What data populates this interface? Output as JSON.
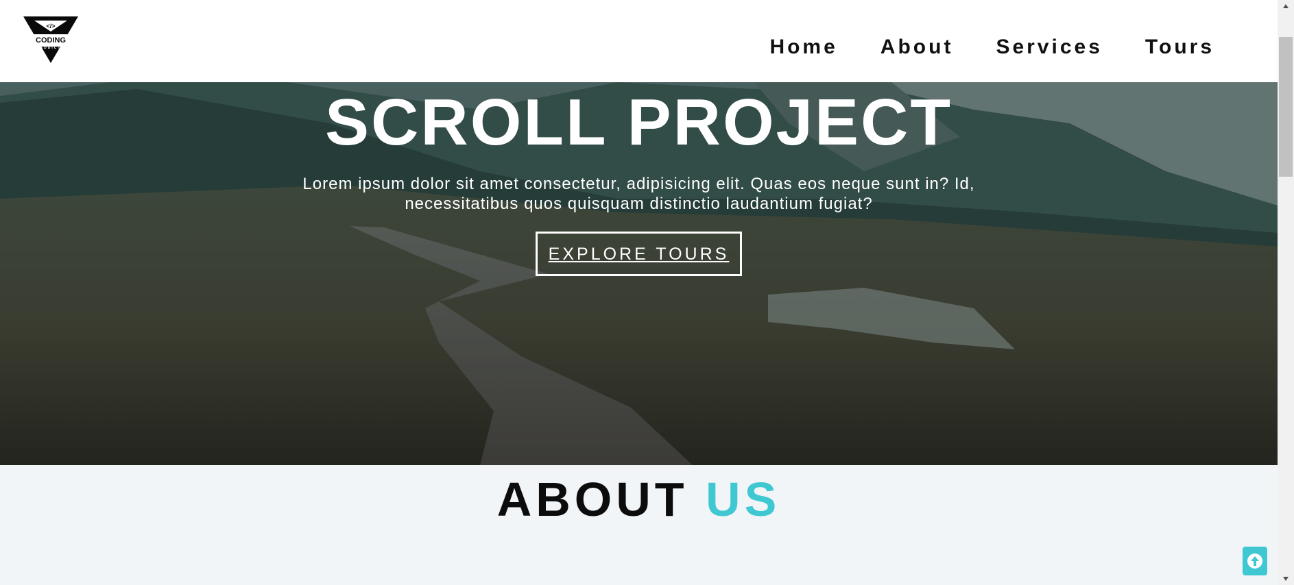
{
  "brand": {
    "logo_text": "CODING",
    "logo_subtext": "ADDICT",
    "logo_icon": "code-brackets-icon"
  },
  "nav": {
    "items": [
      {
        "label": "Home"
      },
      {
        "label": "About"
      },
      {
        "label": "Services"
      },
      {
        "label": "Tours"
      }
    ]
  },
  "hero": {
    "title": "SCROLL PROJECT",
    "text": "Lorem ipsum dolor sit amet consectetur, adipisicing elit. Quas eos neque sunt in? Id, necessitatibus quos quisquam distinctio laudantium fugiat?",
    "button_label": "EXPLORE TOURS",
    "background": "mountain-valley-boardwalk-photo"
  },
  "about": {
    "title_main": "ABOUT",
    "title_accent": "US"
  },
  "scroll_top": {
    "icon": "arrow-up-icon"
  },
  "colors": {
    "accent": "#3fc8d2",
    "nav_text": "#111111",
    "page_bg": "#f1f5f8"
  }
}
